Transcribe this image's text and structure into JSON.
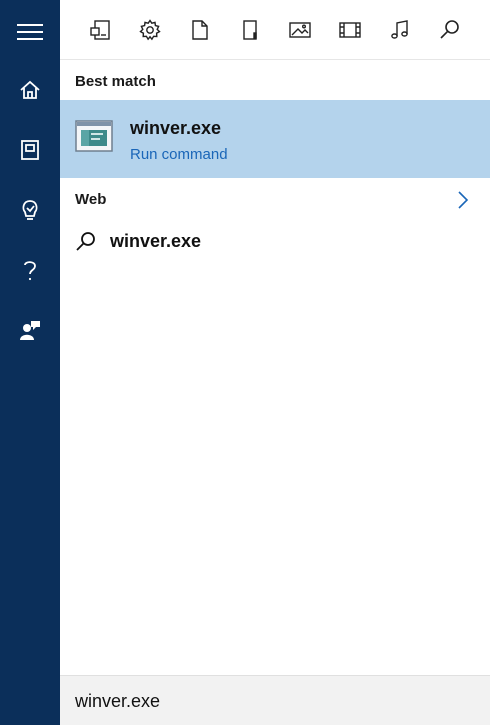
{
  "sidebar": {
    "items": [
      {
        "icon": "hamburger-menu-icon"
      },
      {
        "icon": "home-icon"
      },
      {
        "icon": "notebook-icon"
      },
      {
        "icon": "lightbulb-icon"
      },
      {
        "icon": "help-icon"
      },
      {
        "icon": "feedback-icon"
      }
    ]
  },
  "filters": {
    "items": [
      {
        "icon": "apps-icon"
      },
      {
        "icon": "settings-gear-icon"
      },
      {
        "icon": "document-icon"
      },
      {
        "icon": "folder-icon"
      },
      {
        "icon": "photo-icon"
      },
      {
        "icon": "video-icon"
      },
      {
        "icon": "music-icon"
      },
      {
        "icon": "search-icon"
      }
    ]
  },
  "best_match": {
    "title": "Best match",
    "item": {
      "name": "winver.exe",
      "subtitle": "Run command",
      "icon": "run-command-window-icon"
    }
  },
  "web": {
    "title": "Web",
    "suggestion": {
      "text": "winver.exe",
      "icon": "search-icon"
    },
    "more_icon": "chevron-right-icon"
  },
  "search": {
    "value": "winver.exe"
  },
  "colors": {
    "sidebar": "#0b2f5a",
    "selected_row": "#b4d3ec",
    "accent": "#1a66b8",
    "search_bg": "#f2f2f2"
  }
}
